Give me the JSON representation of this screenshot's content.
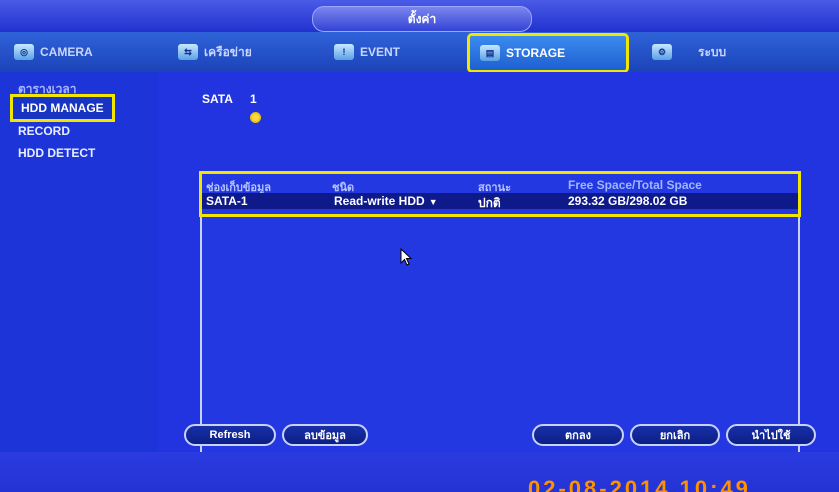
{
  "window": {
    "title": "ตั้งค่า"
  },
  "tabs": [
    {
      "label": "CAMERA",
      "icon": "camera-icon"
    },
    {
      "label": "เครือข่าย",
      "icon": "network-icon"
    },
    {
      "label": "EVENT",
      "icon": "event-icon"
    },
    {
      "label": "STORAGE",
      "icon": "storage-icon",
      "active": true
    },
    {
      "label": "ระบบ",
      "icon": "system-icon"
    }
  ],
  "sidebar": {
    "items": [
      {
        "label": "ตารางเวลา"
      },
      {
        "label": "HDD MANAGE",
        "selected": true
      },
      {
        "label": "RECORD"
      },
      {
        "label": "HDD DETECT"
      }
    ]
  },
  "main": {
    "sata_label": "SATA",
    "sata_number": "1"
  },
  "table": {
    "columns": [
      "ช่องเก็บข้อมูล",
      "ชนิด",
      "สถานะ",
      "Free Space/Total Space"
    ],
    "rows": [
      {
        "device": "SATA-1",
        "type": "Read-write HDD",
        "status": "ปกติ",
        "space": "293.32 GB/298.02 GB"
      }
    ]
  },
  "buttons": {
    "refresh": "Refresh",
    "format": "ลบข้อมูล",
    "ok": "ตกลง",
    "cancel": "ยกเลิก",
    "apply": "นำไปใช้"
  },
  "timestamp": "02-08-2014 10:49",
  "colors": {
    "background": "#1a2bd6",
    "highlight": "#f2e600",
    "timestamp": "#ff9000"
  }
}
